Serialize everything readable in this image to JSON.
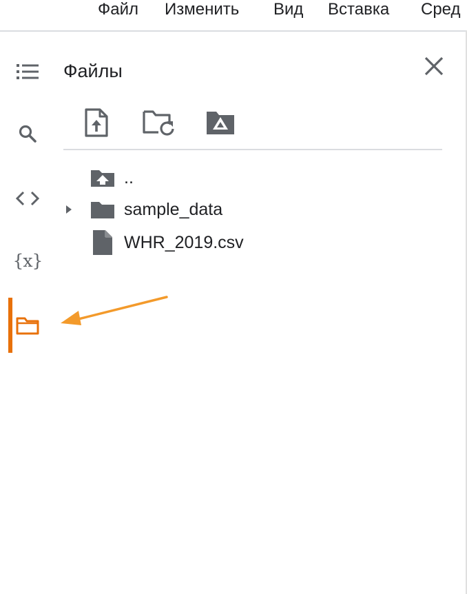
{
  "menubar": {
    "items": [
      {
        "label": "Файл"
      },
      {
        "label": "Изменить"
      },
      {
        "label": "Вид"
      },
      {
        "label": "Вставка"
      },
      {
        "label": "Сред"
      }
    ]
  },
  "sidebar": {
    "items": [
      {
        "icon": "table-of-contents-icon"
      },
      {
        "icon": "search-icon"
      },
      {
        "icon": "code-snippets-icon"
      },
      {
        "icon": "variables-icon",
        "glyph": "{x}"
      },
      {
        "icon": "folder-icon",
        "active": true
      }
    ],
    "accent_color": "#e8710a"
  },
  "files_panel": {
    "title": "Файлы",
    "toolbar": [
      {
        "icon": "upload-file-icon"
      },
      {
        "icon": "refresh-folder-icon"
      },
      {
        "icon": "mount-drive-icon"
      }
    ],
    "tree": [
      {
        "name": "..",
        "icon": "parent-folder-icon",
        "expandable": false
      },
      {
        "name": "sample_data",
        "icon": "folder-icon",
        "expandable": true
      },
      {
        "name": "WHR_2019.csv",
        "icon": "file-icon",
        "expandable": false
      }
    ]
  },
  "annotation": {
    "arrow_color": "#f39a2b"
  },
  "colors": {
    "icon": "#5f6368",
    "text": "#202124",
    "divider": "#dadce0"
  }
}
